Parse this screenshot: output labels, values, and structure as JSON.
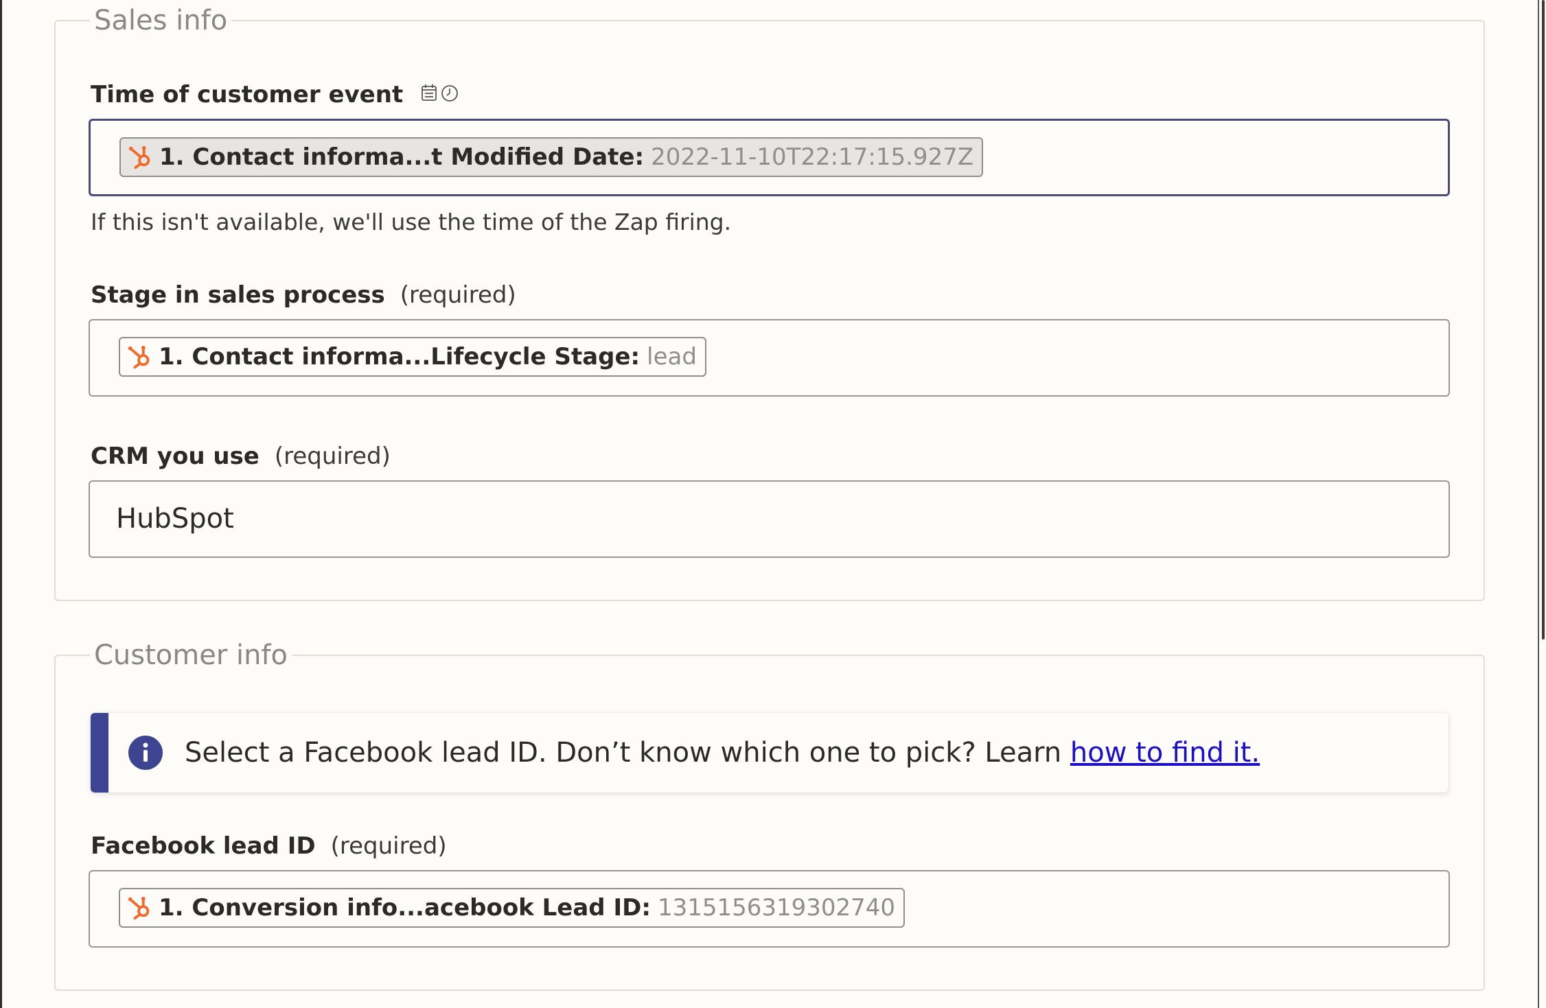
{
  "sales_section": {
    "legend": "Sales info",
    "time_field": {
      "label": "Time of customer event",
      "pill_label": "1. Contact informa...t Modified Date:",
      "pill_value": "2022-11-10T22:17:15.927Z",
      "help": "If this isn't available, we'll use the time of the Zap firing."
    },
    "stage_field": {
      "label": "Stage in sales process",
      "required": "(required)",
      "pill_label": "1. Contact informa...Lifecycle Stage:",
      "pill_value": "lead"
    },
    "crm_field": {
      "label": "CRM you use",
      "required": "(required)",
      "value": "HubSpot"
    }
  },
  "customer_section": {
    "legend": "Customer info",
    "alert": {
      "text": "Select a Facebook lead ID. Don’t know which one to pick? Learn ",
      "link": "how to find it."
    },
    "lead_field": {
      "label": "Facebook lead ID",
      "required": "(required)",
      "pill_label": "1. Conversion info...acebook Lead ID:",
      "pill_value": "1315156319302740"
    }
  },
  "icons": {
    "hubspot": "hubspot-icon",
    "calendar": "calendar-icon",
    "clock": "clock-icon",
    "info": "info-icon"
  },
  "colors": {
    "hubspot_orange": "#f26a2b",
    "info_accent": "#3d4592",
    "link": "#1a0dcc",
    "focus_border": "#4b4a78"
  }
}
